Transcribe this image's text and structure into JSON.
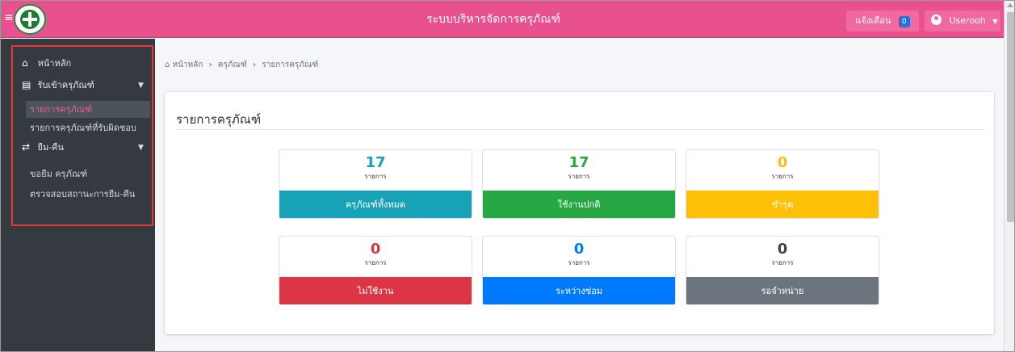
{
  "header": {
    "app_title": "ระบบบริหารจัดการครุภัณฑ์",
    "notification_label": "แจ้งเตือน",
    "notification_count": "0",
    "user_name": "Userooh"
  },
  "sidebar": {
    "home": "หน้าหลัก",
    "receive_group": "รับเข้าครุภัณฑ์",
    "receive_items": [
      "รายการครุภัณฑ์",
      "รายการครุภัณฑ์ที่รับผิดชอบ"
    ],
    "borrow_group": "ยืม-คืน",
    "borrow_items": [
      "ขอยืม ครุภัณฑ์",
      "ตรวจสอบสถานะการยืม-คืน"
    ]
  },
  "breadcrumb": [
    "หน้าหลัก",
    "ครุภัณฑ์",
    "รายการครุภัณฑ์"
  ],
  "page_title": "รายการครุภัณฑ์",
  "stats": [
    {
      "value": "17",
      "unit": "รายการ",
      "label": "ครุภัณฑ์ทั้งหมด",
      "color": "#17a2b8"
    },
    {
      "value": "17",
      "unit": "รายการ",
      "label": "ใช้งานปกติ",
      "color": "#28a745"
    },
    {
      "value": "0",
      "unit": "รายการ",
      "label": "ชำรุด",
      "color": "#ffc107"
    },
    {
      "value": "0",
      "unit": "รายการ",
      "label": "ไม่ใช้งาน",
      "color": "#dc3545"
    },
    {
      "value": "0",
      "unit": "รายการ",
      "label": "ระหว่างซ่อม",
      "color": "#007bff"
    },
    {
      "value": "0",
      "unit": "รายการ",
      "label": "รอจำหน่าย",
      "color": "#6c757d"
    }
  ]
}
